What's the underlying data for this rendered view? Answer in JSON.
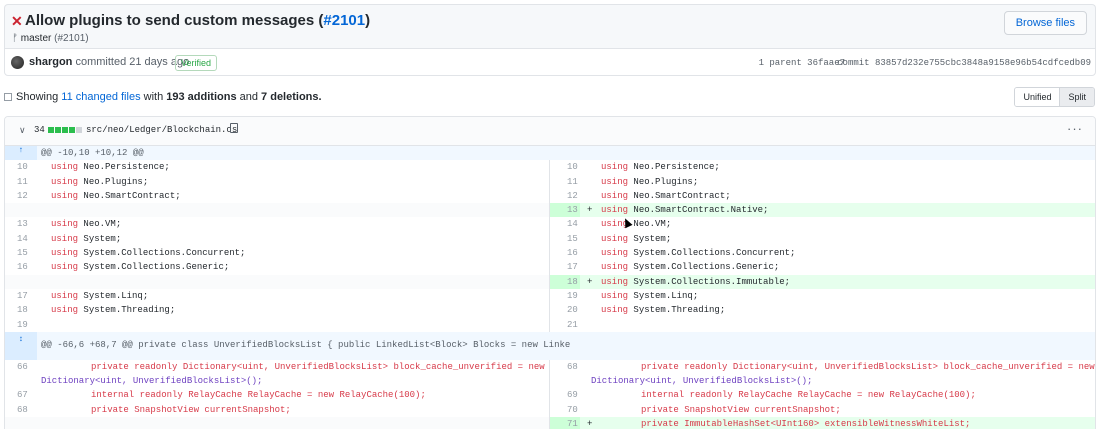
{
  "commit": {
    "title": "Allow plugins to send custom messages (",
    "pr_number": "#2101",
    "title_end": ")",
    "branch_label": "master",
    "branch_pr": "(#2101)",
    "browse_label": "Browse files",
    "author": "shargon",
    "committed": "committed 21 days ago",
    "verified": "Verified",
    "parent": "1 parent 36faae7",
    "sha": "commit 83857d232e755cbc3848a9158e96b54cdfcedb09"
  },
  "summary": {
    "prefix": "Showing",
    "files": "11 changed files",
    "mid": "with",
    "additions": "193 additions",
    "and": "and",
    "deletions": "7 deletions."
  },
  "view": {
    "unified": "Unified",
    "split": "Split"
  },
  "file": {
    "count": "34",
    "name": "src/neo/Ledger/Blockchain.cs",
    "more": "···"
  },
  "hunks": {
    "h1": "@@ -10,10 +10,12 @@",
    "h2": "@@ -66,6 +68,7 @@ private class UnverifiedBlocksList { public LinkedList<Block> Blocks = new Linke"
  },
  "lines": {
    "l10": "10",
    "l11": "11",
    "l12": "12",
    "l13": "13",
    "l14": "14",
    "l15": "15",
    "l16": "16",
    "l17": "17",
    "l18": "18",
    "l19": "19",
    "l66": "66",
    "l67": "67",
    "l68": "68",
    "r10": "10",
    "r11": "11",
    "r12": "12",
    "r13": "13",
    "r14": "14",
    "r15": "15",
    "r16": "16",
    "r17": "17",
    "r18": "18",
    "r19": "19",
    "r20": "20",
    "r21": "21",
    "r68": "68",
    "r69": "69",
    "r70": "70",
    "r71": "71"
  },
  "code": {
    "using": "using",
    "persistence": "Neo.Persistence;",
    "plugins": "Neo.Plugins;",
    "smartcontract": "Neo.SmartContract;",
    "native": "Neo.SmartContract.Native;",
    "vm": "Neo.VM;",
    "system": "System;",
    "concurrent": "System.Collections.Concurrent;",
    "generic": "System.Collections.Generic;",
    "immutable": "System.Collections.Immutable;",
    "linq": "System.Linq;",
    "threading": "System.Threading;",
    "dict1a": "private readonly Dictionary<uint, UnverifiedBlocksList> block_cache_unverified = new",
    "dict1b": "Dictionary<uint, UnverifiedBlocksList>();",
    "relay": "internal readonly RelayCache RelayCache = new RelayCache(100);",
    "snapshot": "private SnapshotView currentSnapshot;",
    "witness": "private ImmutableHashSet<UInt160> extensibleWitnessWhiteList;"
  },
  "markers": {
    "plus": "+",
    "expand_up": "↑",
    "expand_both": "↕"
  },
  "colors": {
    "accent": "#0366d6",
    "added_bg": "#e6ffed",
    "added_gutter": "#cdffd8",
    "hunk_bg": "#f1f8ff",
    "keyword": "#d73a49",
    "diffstat_green": "#2cbe4e",
    "diffstat_gray": "#d1d5da"
  }
}
